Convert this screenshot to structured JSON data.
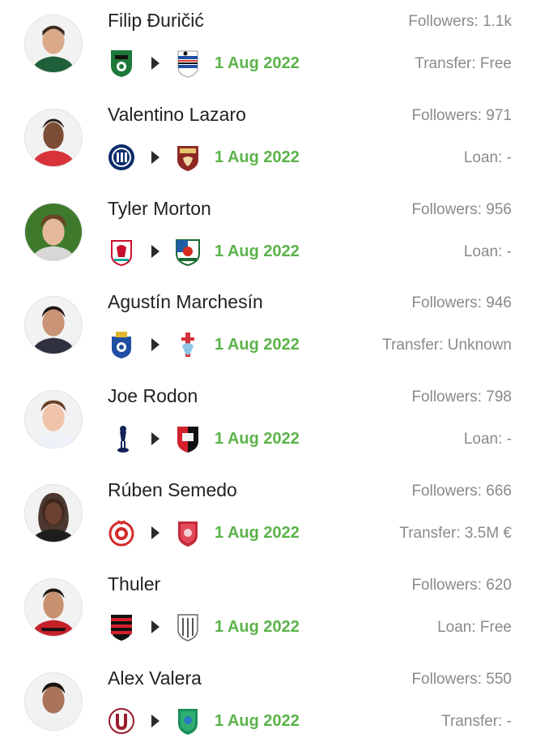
{
  "accent_color": "#5bb349",
  "players": [
    {
      "name": "Filip Đuričić",
      "followers": "Followers: 1.1k",
      "date": "1 Aug 2022",
      "transfer": "Transfer: Free",
      "from_club_icon": "sassuolo-crest-icon",
      "to_club_icon": "sampdoria-crest-icon"
    },
    {
      "name": "Valentino Lazaro",
      "followers": "Followers: 971",
      "date": "1 Aug 2022",
      "transfer": "Loan: -",
      "from_club_icon": "inter-crest-icon",
      "to_club_icon": "torino-crest-icon"
    },
    {
      "name": "Tyler Morton",
      "followers": "Followers: 956",
      "date": "1 Aug 2022",
      "transfer": "Loan: -",
      "from_club_icon": "liverpool-crest-icon",
      "to_club_icon": "blackburn-crest-icon"
    },
    {
      "name": "Agustín Marchesín",
      "followers": "Followers: 946",
      "date": "1 Aug 2022",
      "transfer": "Transfer: Unknown",
      "from_club_icon": "porto-crest-icon",
      "to_club_icon": "celta-crest-icon"
    },
    {
      "name": "Joe Rodon",
      "followers": "Followers: 798",
      "date": "1 Aug 2022",
      "transfer": "Loan: -",
      "from_club_icon": "tottenham-crest-icon",
      "to_club_icon": "rennes-crest-icon"
    },
    {
      "name": "Rúben Semedo",
      "followers": "Followers: 666",
      "date": "1 Aug 2022",
      "transfer": "Transfer: 3.5M €",
      "from_club_icon": "olympiacos-crest-icon",
      "to_club_icon": "al-duhail-crest-icon"
    },
    {
      "name": "Thuler",
      "followers": "Followers: 620",
      "date": "1 Aug 2022",
      "transfer": "Loan: Free",
      "from_club_icon": "flamengo-crest-icon",
      "to_club_icon": "vissel-kobe-crest-icon"
    },
    {
      "name": "Alex Valera",
      "followers": "Followers: 550",
      "date": "1 Aug 2022",
      "transfer": "Transfer: -",
      "from_club_icon": "universitario-crest-icon",
      "to_club_icon": "al-fateh-crest-icon"
    }
  ]
}
